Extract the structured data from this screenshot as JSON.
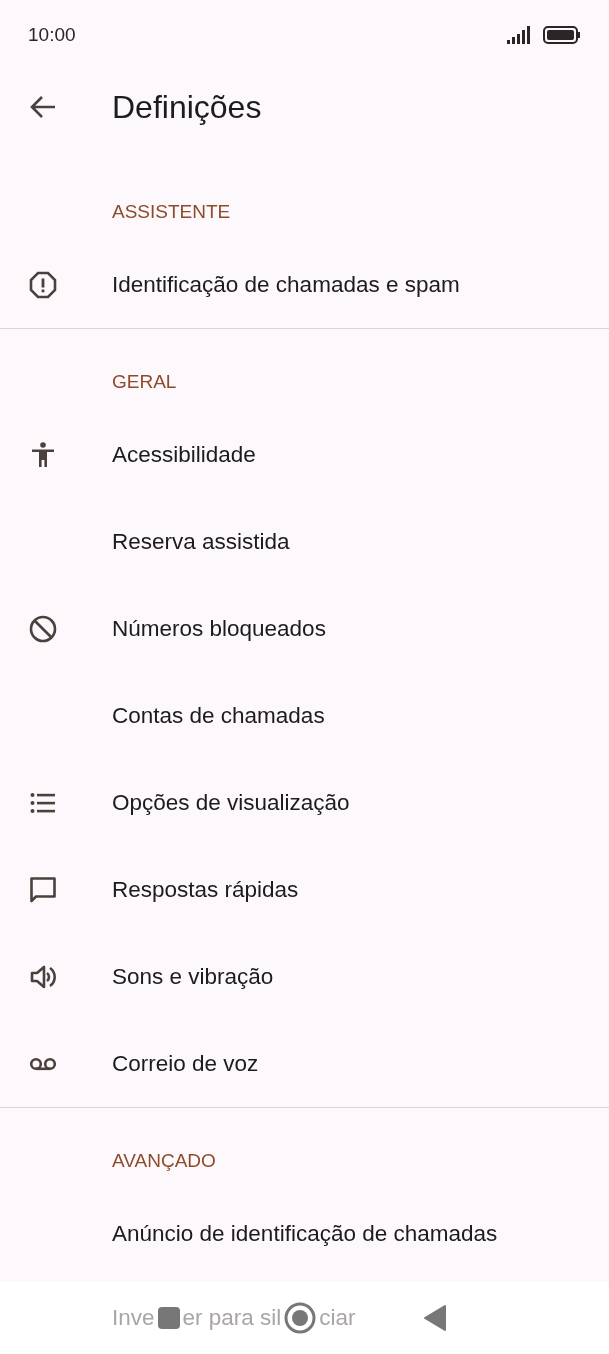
{
  "status_bar": {
    "time": "10:00"
  },
  "header": {
    "title": "Definições"
  },
  "sections": [
    {
      "title": "ASSISTENTE",
      "items": [
        {
          "label": "Identificação de chamadas e spam",
          "kind": "alert"
        }
      ]
    },
    {
      "title": "GERAL",
      "items": [
        {
          "label": "Acessibilidade",
          "kind": "accessibility"
        },
        {
          "label": "Reserva assistida",
          "kind": "plain"
        },
        {
          "label": "Números bloqueados",
          "kind": "block"
        },
        {
          "label": "Contas de chamadas",
          "kind": "plain"
        },
        {
          "label": "Opções de visualização",
          "kind": "list"
        },
        {
          "label": "Respostas rápidas",
          "kind": "message"
        },
        {
          "label": "Sons e vibração",
          "kind": "sound"
        },
        {
          "label": "Correio de voz",
          "kind": "voicemail"
        }
      ]
    },
    {
      "title": "AVANÇADO",
      "items": [
        {
          "label": "Anúncio de identificação de chamadas",
          "kind": "plain"
        }
      ],
      "covered_item": {
        "label_parts": [
          "Inve",
          "er para sil",
          "ciar"
        ]
      }
    }
  ]
}
